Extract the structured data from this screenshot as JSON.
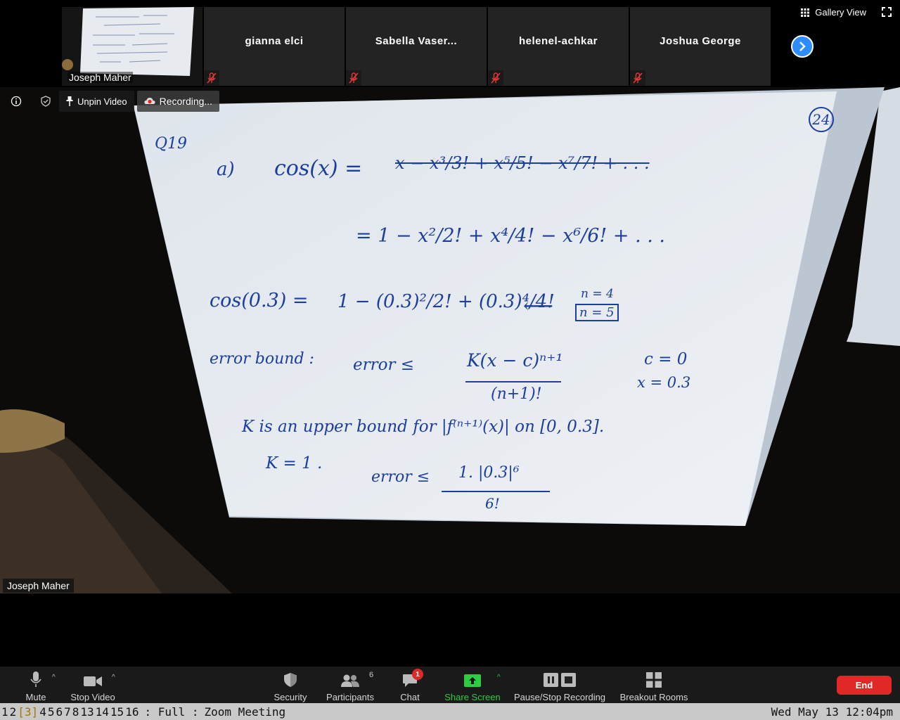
{
  "gallery": {
    "thumb_name": "Joseph Maher",
    "participants": [
      {
        "name": "gianna elci"
      },
      {
        "name": "Sabella Vaser..."
      },
      {
        "name": "helenel-achkar"
      },
      {
        "name": "Joshua George"
      }
    ],
    "view_label": "Gallery View"
  },
  "main": {
    "unpin_label": "Unpin Video",
    "recording_label": "Recording...",
    "speaker_name": "Joseph Maher"
  },
  "toolbar": {
    "mute_label": "Mute",
    "stop_video_label": "Stop Video",
    "security_label": "Security",
    "participants_label": "Participants",
    "participants_count": "6",
    "chat_label": "Chat",
    "chat_badge": "1",
    "share_label": "Share Screen",
    "pause_label": "Pause/Stop Recording",
    "breakout_label": "Breakout Rooms",
    "end_label": "End"
  },
  "statusbar": {
    "workspaces": [
      "1",
      "2",
      "[3]",
      "4",
      "5",
      "6",
      "7",
      "8",
      "13",
      "14",
      "15",
      "16"
    ],
    "layout": ": Full :",
    "window_title": "Zoom Meeting",
    "datetime": "Wed May 13 12:04pm"
  },
  "whiteboard": {
    "page_no": "24",
    "lines": {
      "q": "Q19",
      "a": "a)",
      "cos_x": "cos(x) =",
      "struck_series": "x − x³/3! + x⁵/5! − x⁷/7! + . . .",
      "series": "= 1 − x²/2! + x⁴/4! − x⁶/6! + . . .",
      "cos03": "cos(0.3) =",
      "expansion": "1 − (0.3)²/2! + (0.3)⁴/4!",
      "n4": "n = 4",
      "n5": "n = 5",
      "eb": "error bound :",
      "err1": "error ≤",
      "frac1_num": "K(x − c)ⁿ⁺¹",
      "frac1_den": "(n+1)!",
      "c0": "c = 0",
      "x03": "x = 0.3",
      "kline": "K is an upper bound for |f⁽ⁿ⁺¹⁾(x)| on [0, 0.3].",
      "k1": "K = 1 .",
      "err2": "error ≤",
      "frac2_num": "1. |0.3|⁶",
      "frac2_den": "6!"
    }
  },
  "colors": {
    "ink": "#1c3f9e",
    "end": "#e02828",
    "share": "#2ecc40",
    "accent": "#2d8cff"
  }
}
